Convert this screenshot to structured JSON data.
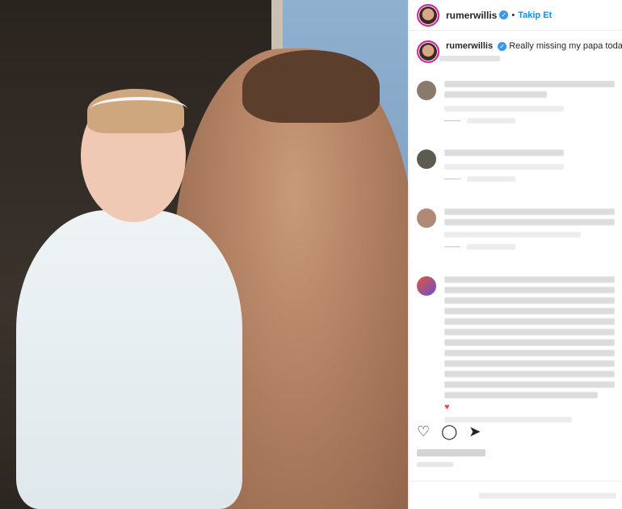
{
  "post": {
    "username": "rumerwillis",
    "follow_label": "Takip Et",
    "separator": "•",
    "verified_glyph": "✓",
    "caption_text": "Really missing my papa today.",
    "caption_emoji": "😀"
  },
  "colors": {
    "accent": "#0095f6",
    "verified": "#3897f0",
    "heart": "#ed4956"
  },
  "icons": {
    "heart": "♥",
    "like": "♡",
    "comment": "◯",
    "share": "➤"
  }
}
